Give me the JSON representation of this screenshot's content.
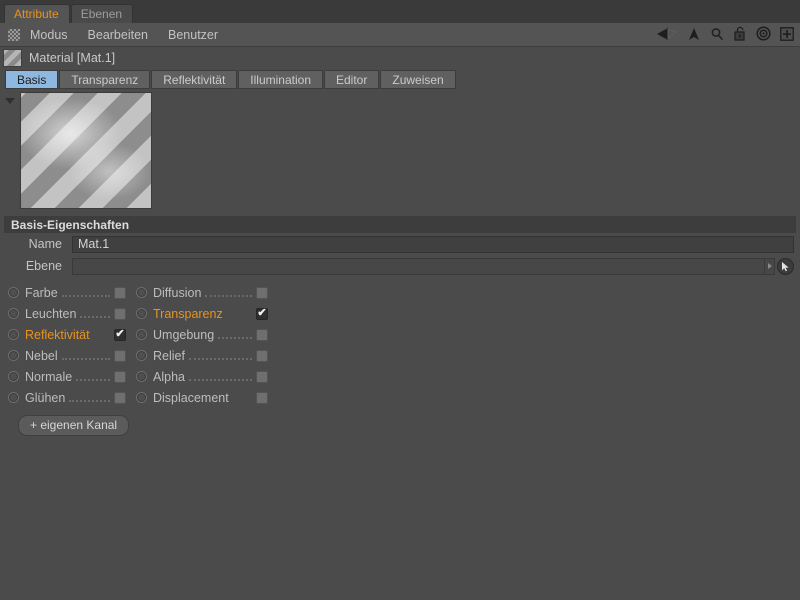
{
  "window": {
    "panel_tabs": [
      {
        "label": "Attribute",
        "active": true
      },
      {
        "label": "Ebenen",
        "active": false
      }
    ]
  },
  "menubar": {
    "grid_icon": "grid-icon",
    "items": [
      "Modus",
      "Bearbeiten",
      "Benutzer"
    ],
    "right_icons": [
      "back-arrow-icon",
      "up-arrow-icon",
      "search-icon",
      "lock-icon",
      "target-icon",
      "plus-icon"
    ]
  },
  "material": {
    "icon": "material-swatch-icon",
    "title": "Material [Mat.1]",
    "tabs": [
      {
        "label": "Basis",
        "active": true
      },
      {
        "label": "Transparenz",
        "active": false
      },
      {
        "label": "Reflektivität",
        "active": false
      },
      {
        "label": "Illumination",
        "active": false
      },
      {
        "label": "Editor",
        "active": false
      },
      {
        "label": "Zuweisen",
        "active": false
      }
    ]
  },
  "preview": {
    "collapse_icon": "triangle-down-icon"
  },
  "basis": {
    "section_title": "Basis-Eigenschaften",
    "name_label": "Name",
    "name_value": "Mat.1",
    "ebene_label": "Ebene",
    "ebene_value": "",
    "ebene_placeholder": "",
    "ebene_dropdown_icon": "chevron-right-icon",
    "ebene_picker_icon": "cursor-pointer-icon"
  },
  "channels": {
    "left": [
      {
        "label": "Farbe",
        "checked": false,
        "highlight": false
      },
      {
        "label": "Leuchten",
        "checked": false,
        "highlight": false
      },
      {
        "label": "Reflektivität",
        "checked": true,
        "highlight": true
      },
      {
        "label": "Nebel",
        "checked": false,
        "highlight": false
      },
      {
        "label": "Normale",
        "checked": false,
        "highlight": false
      },
      {
        "label": "Glühen",
        "checked": false,
        "highlight": false
      }
    ],
    "right": [
      {
        "label": "Diffusion",
        "checked": false,
        "highlight": false
      },
      {
        "label": "Transparenz",
        "checked": true,
        "highlight": true
      },
      {
        "label": "Umgebung",
        "checked": false,
        "highlight": false
      },
      {
        "label": "Relief",
        "checked": false,
        "highlight": false
      },
      {
        "label": "Alpha",
        "checked": false,
        "highlight": false
      },
      {
        "label": "Displacement",
        "checked": false,
        "highlight": false
      }
    ],
    "check_glyph": "✔",
    "add_channel_label": "+ eigenen Kanal"
  },
  "colors": {
    "accent_orange": "#e8921f",
    "tab_active_blue": "#8fb8e0",
    "panel_bg": "#4b4b4b",
    "menubar_bg": "#545454",
    "section_header_bg": "#3d3d3d"
  }
}
